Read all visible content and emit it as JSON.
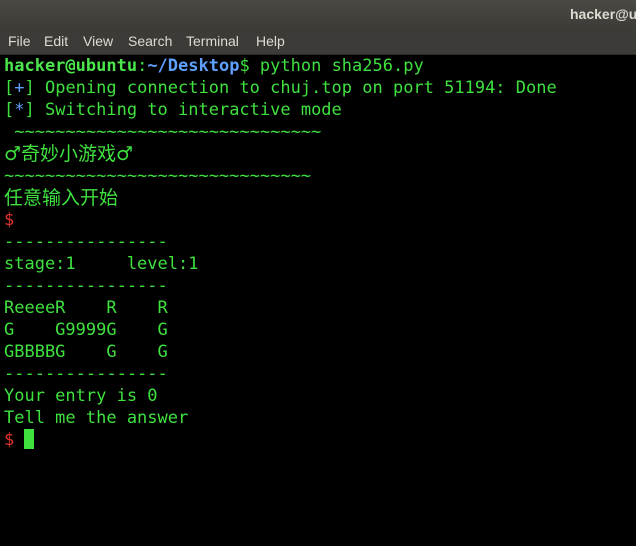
{
  "window": {
    "title": "hacker@u"
  },
  "menu": [
    "File",
    "Edit",
    "View",
    "Search",
    "Terminal",
    "Help"
  ],
  "prompt": {
    "user_host": "hacker@ubuntu",
    "colon": ":",
    "path": "~/Desktop",
    "dollar": "$",
    "command": " python sha256.py"
  },
  "log": {
    "line1_open": "[",
    "line1_sym": "+",
    "line1_text": "] Opening connection to chuj.top on port 51194: Done",
    "line2_open": "[",
    "line2_sym": "*",
    "line2_text": "] Switching to interactive mode"
  },
  "game": {
    "tilde_top": " ~~~~~~~~~~~~~~~~~~~~~~~~~~~~~~",
    "title": "♂奇妙小游戏♂",
    "tilde_bottom": "~~~~~~~~~~~~~~~~~~~~~~~~~~~~~~",
    "start_hint": "任意输入开始",
    "prompt1": "$",
    "dash1": "----------------",
    "stage": "stage:1     level:1",
    "dash2": "----------------",
    "grid_row1": "ReeeeR    R    R",
    "grid_row2": "G    G9999G    G",
    "grid_row3": "GBBBBG    G    G",
    "dash3": "----------------",
    "entry": "Your entry is 0",
    "question": "Tell me the answer",
    "prompt2": "$"
  }
}
